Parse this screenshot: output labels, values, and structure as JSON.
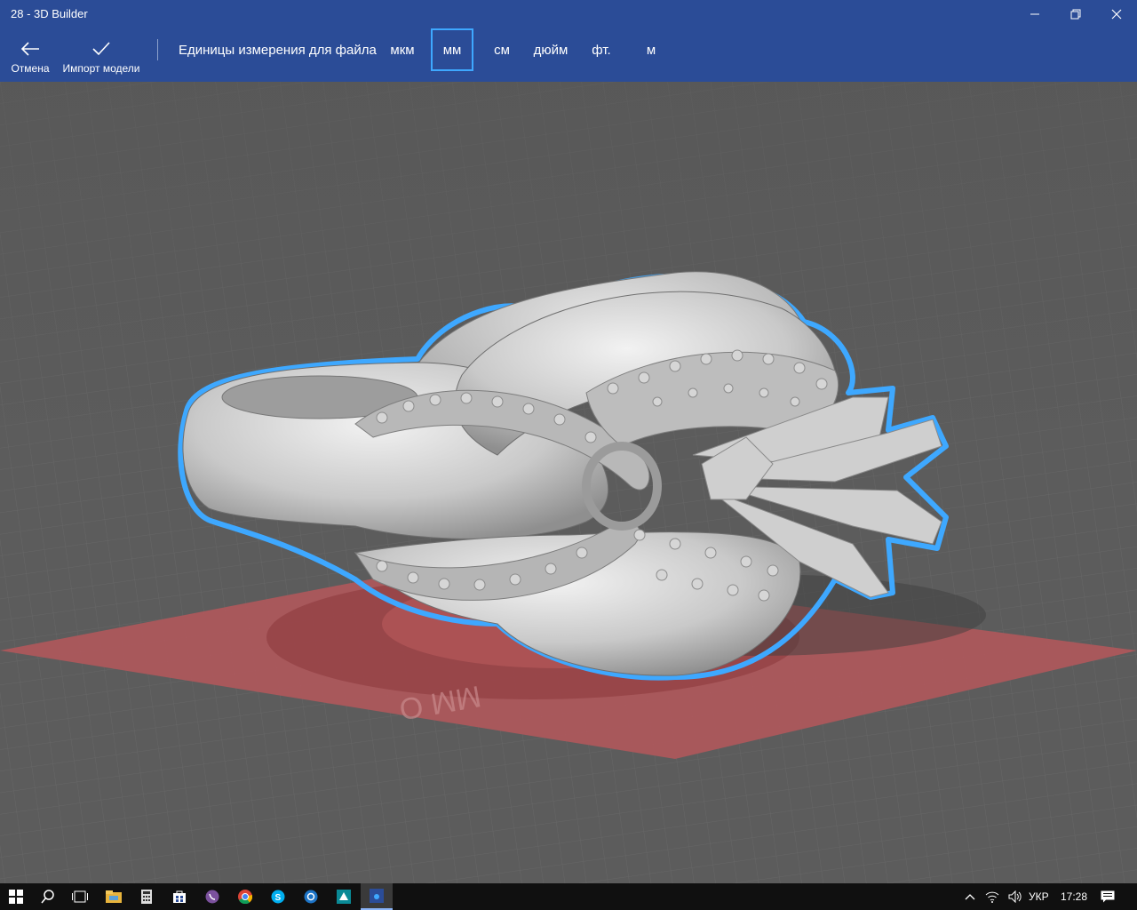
{
  "window": {
    "title": "28 - 3D Builder"
  },
  "commands": {
    "cancel_label": "Отмена",
    "import_label": "Импорт модели"
  },
  "units": {
    "label": "Единицы измерения для файла",
    "options": [
      "мкм",
      "мм",
      "см",
      "дюйм",
      "фт.",
      "м"
    ],
    "selected": "мм"
  },
  "taskbar": {
    "language": "УКР",
    "time": "17:28",
    "apps": [
      "start-icon",
      "search-icon",
      "task-view-icon",
      "file-explorer-icon",
      "calculator-icon",
      "store-icon",
      "viber-icon",
      "chrome-icon",
      "skype-icon",
      "settings-app-icon",
      "3d-builder-icon",
      "active-app-icon"
    ]
  },
  "colors": {
    "accent": "#2b4c97",
    "selection_outline": "#3ea8ff",
    "platform": "#b84a4a",
    "background": "#5b5b5b"
  }
}
